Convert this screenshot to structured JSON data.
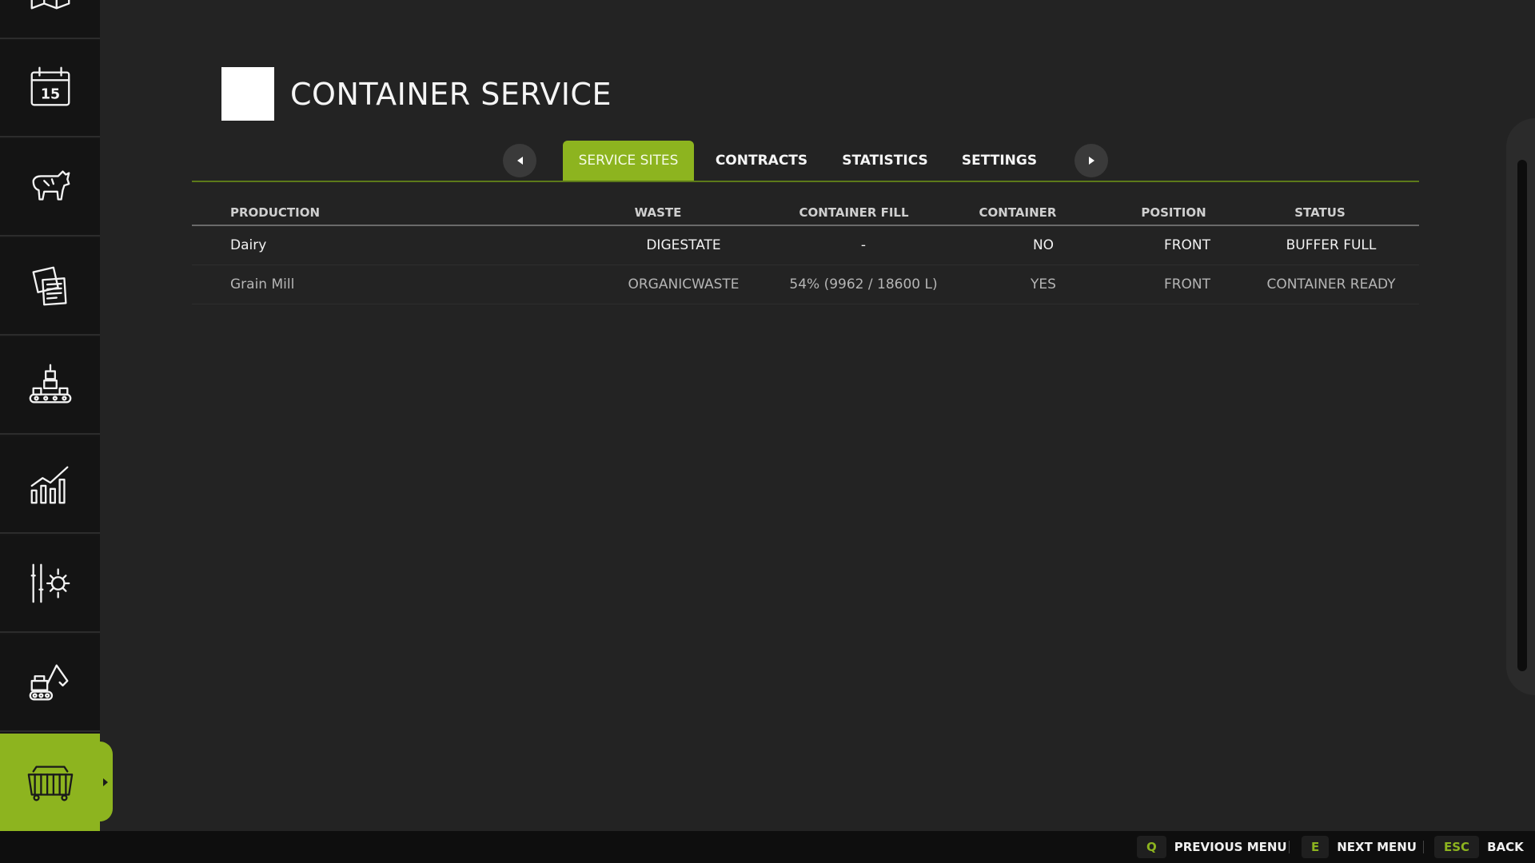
{
  "header": {
    "title": "CONTAINER SERVICE"
  },
  "tabs": [
    {
      "label": "SERVICE SITES",
      "active": true
    },
    {
      "label": "CONTRACTS",
      "active": false
    },
    {
      "label": "STATISTICS",
      "active": false
    },
    {
      "label": "SETTINGS",
      "active": false
    }
  ],
  "sidebar": {
    "items": [
      {
        "icon": "map-icon"
      },
      {
        "icon": "calendar-icon",
        "text": "15"
      },
      {
        "icon": "cow-icon"
      },
      {
        "icon": "documents-icon"
      },
      {
        "icon": "production-icon"
      },
      {
        "icon": "chart-icon"
      },
      {
        "icon": "settings-icon"
      },
      {
        "icon": "excavator-icon"
      },
      {
        "icon": "container-icon",
        "active": true
      }
    ]
  },
  "table": {
    "columns": [
      "PRODUCTION",
      "WASTE",
      "CONTAINER FILL",
      "CONTAINER",
      "POSITION",
      "STATUS"
    ],
    "rows": [
      {
        "production": "Dairy",
        "waste": "DIGESTATE",
        "fill": "-",
        "container": "NO",
        "position": "FRONT",
        "status": "BUFFER FULL"
      },
      {
        "production": "Grain Mill",
        "waste": "ORGANICWASTE",
        "fill": "54%  (9962 / 18600 L)",
        "container": "YES",
        "position": "FRONT",
        "status": "CONTAINER READY"
      }
    ]
  },
  "bottom_bar": {
    "hints": [
      {
        "key": "Q",
        "label": "PREVIOUS MENU"
      },
      {
        "key": "E",
        "label": "NEXT MENU"
      },
      {
        "key": "ESC",
        "label": "BACK"
      }
    ]
  },
  "colors": {
    "accent": "#8db41f",
    "background": "#232323",
    "sidebar": "#141414"
  }
}
